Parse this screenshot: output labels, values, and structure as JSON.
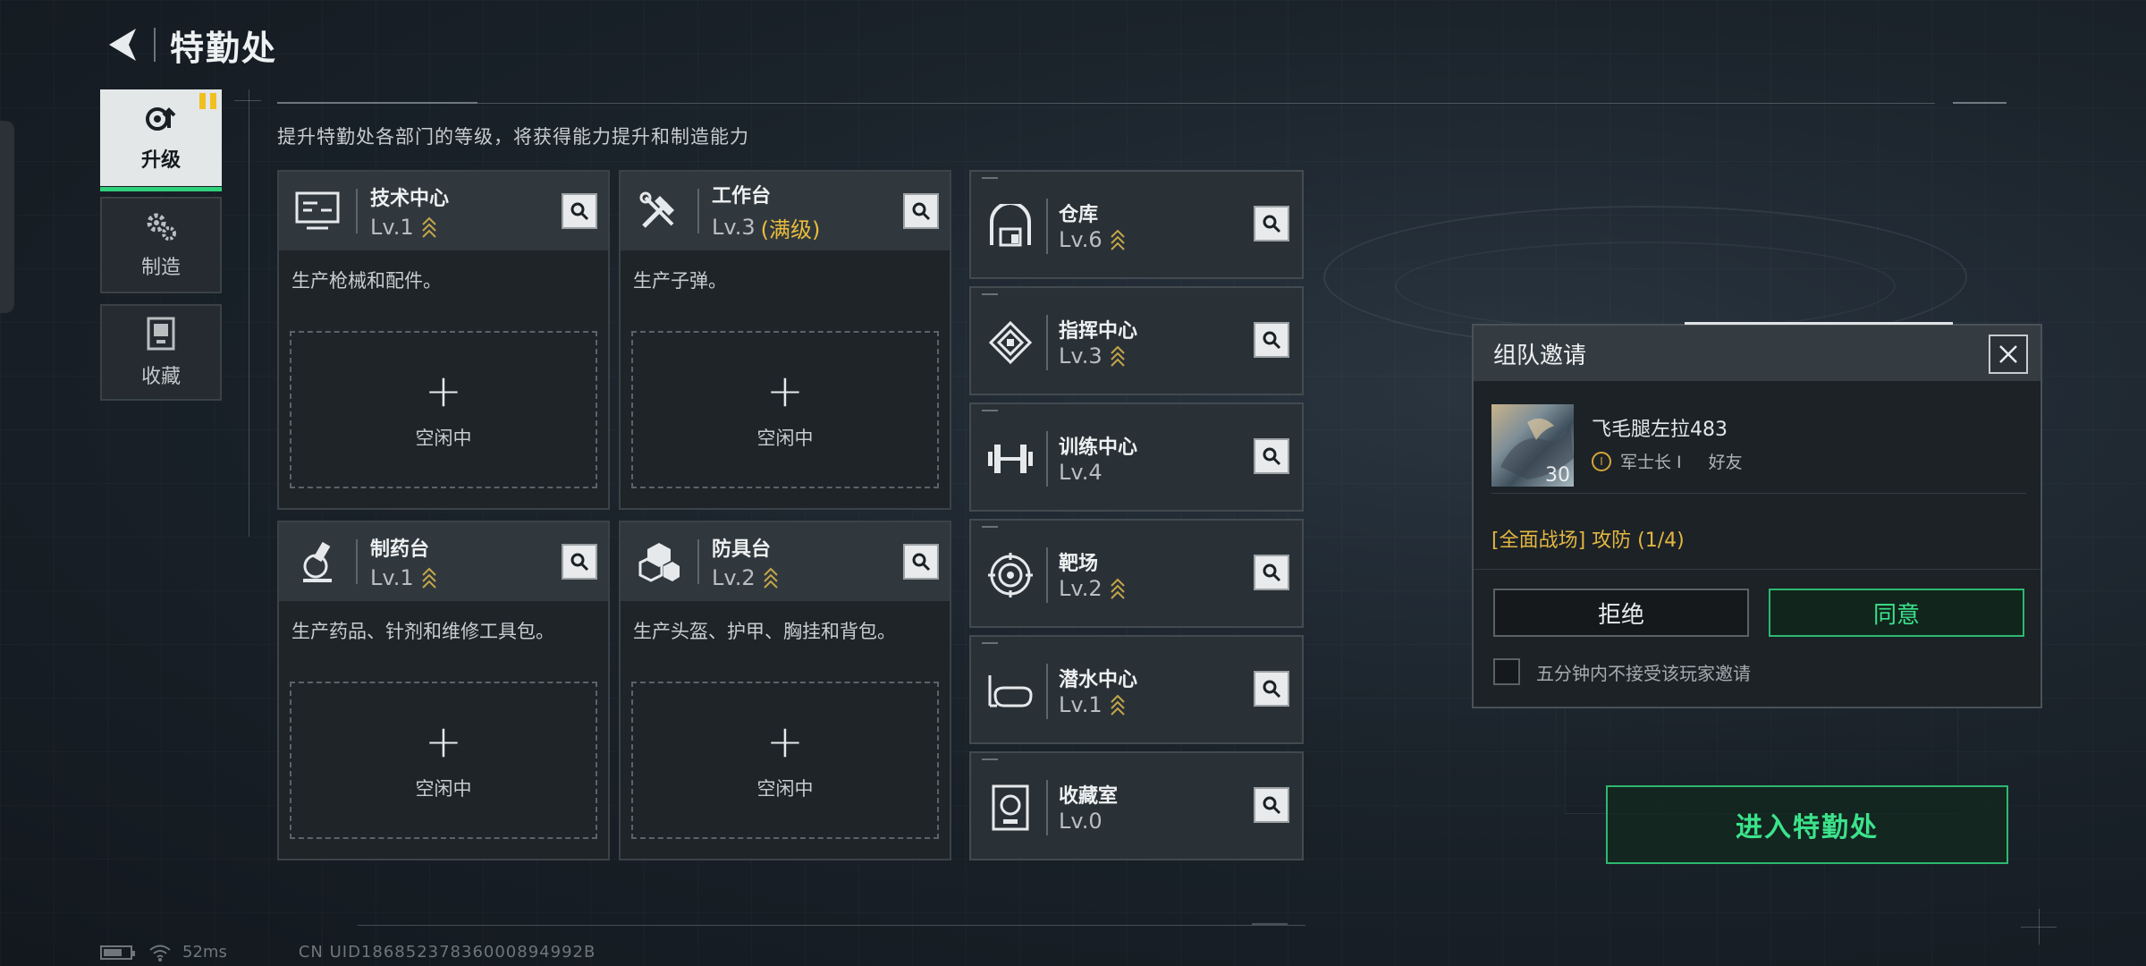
{
  "header": {
    "title": "特勤处"
  },
  "subtitle": "提升特勤处各部门的等级，将获得能力提升和制造能力",
  "nav": [
    {
      "label": "升级",
      "icon": "upgrade-icon",
      "active": true
    },
    {
      "label": "制造",
      "icon": "gears-icon",
      "active": false
    },
    {
      "label": "收藏",
      "icon": "collection-icon",
      "active": false
    }
  ],
  "departments": [
    {
      "name": "技术中心",
      "level": "Lv.1",
      "max": "",
      "desc": "生产枪械和配件。",
      "slot_plus": "+",
      "slot_label": "空闲中",
      "icon": "monitor-icon"
    },
    {
      "name": "工作台",
      "level": "Lv.3",
      "max": "(满级)",
      "desc": "生产子弹。",
      "slot_plus": "+",
      "slot_label": "空闲中",
      "icon": "tools-icon"
    },
    {
      "name": "制药台",
      "level": "Lv.1",
      "max": "",
      "desc": "生产药品、针剂和维修工具包。",
      "slot_plus": "+",
      "slot_label": "空闲中",
      "icon": "microscope-icon"
    },
    {
      "name": "防具台",
      "level": "Lv.2",
      "max": "",
      "desc": "生产头盔、护甲、胸挂和背包。",
      "slot_plus": "+",
      "slot_label": "空闲中",
      "icon": "armor-boxes-icon"
    }
  ],
  "facilities": [
    {
      "name": "仓库",
      "level": "Lv.6",
      "icon": "warehouse-icon"
    },
    {
      "name": "指挥中心",
      "level": "Lv.3",
      "icon": "command-icon"
    },
    {
      "name": "训练中心",
      "level": "Lv.4",
      "icon": "dumbbell-icon"
    },
    {
      "name": "靶场",
      "level": "Lv.2",
      "icon": "target-icon"
    },
    {
      "name": "潜水中心",
      "level": "Lv.1",
      "icon": "diving-mask-icon"
    },
    {
      "name": "收藏室",
      "level": "Lv.0",
      "icon": "collection-room-icon"
    }
  ],
  "invite": {
    "title": "组队邀请",
    "player_name": "飞毛腿左拉483",
    "player_level": "30",
    "rank_badge": "I",
    "rank": "军士长 I",
    "relation": "好友",
    "mode": "[全面战场] 攻防 (1/4)",
    "reject_label": "拒绝",
    "accept_label": "同意",
    "mute_label": "五分钟内不接受该玩家邀请"
  },
  "enter_label": "进入特勤处",
  "status": {
    "ping": "52ms",
    "uid": "CN UID18685237836000894992B"
  },
  "colors": {
    "accent_green": "#2db86f",
    "max_level_gold": "#e9bd3c",
    "badge_yellow": "#f0c020"
  }
}
